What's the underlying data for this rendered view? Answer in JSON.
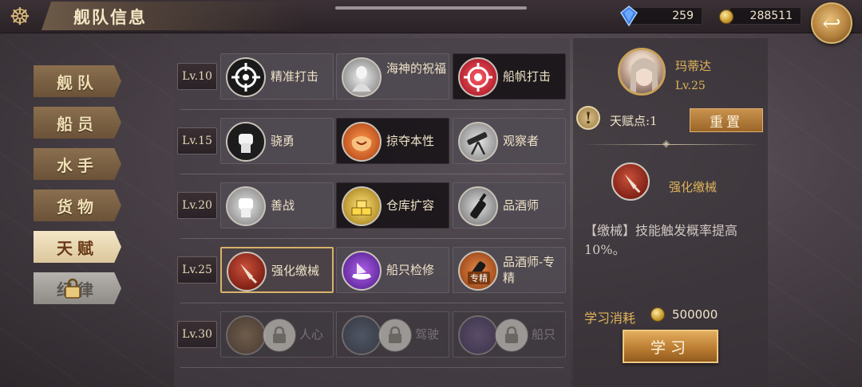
{
  "header": {
    "title": "舰队信息",
    "gems": "259",
    "gold": "288511"
  },
  "tabs": [
    {
      "label": "舰队",
      "state": "normal"
    },
    {
      "label": "船员",
      "state": "normal"
    },
    {
      "label": "水手",
      "state": "normal"
    },
    {
      "label": "货物",
      "state": "normal"
    },
    {
      "label": "天赋",
      "state": "active"
    },
    {
      "label": "纪律",
      "state": "locked"
    }
  ],
  "talent_rows": [
    {
      "level": "Lv.10",
      "skills": [
        {
          "name": "精准打击",
          "icon": "crosshair-icon"
        },
        {
          "name": "海神的祝福",
          "icon": "sea-god-icon"
        },
        {
          "name": "船帆打击",
          "icon": "sail-strike-icon",
          "style": "dark"
        }
      ]
    },
    {
      "level": "Lv.15",
      "skills": [
        {
          "name": "骁勇",
          "icon": "fist-icon"
        },
        {
          "name": "掠夺本性",
          "icon": "plunder-icon",
          "style": "dark"
        },
        {
          "name": "观察者",
          "icon": "telescope-icon"
        }
      ]
    },
    {
      "level": "Lv.20",
      "skills": [
        {
          "name": "善战",
          "icon": "fist-icon"
        },
        {
          "name": "仓库扩容",
          "icon": "gold-bars-icon",
          "style": "dark"
        },
        {
          "name": "品酒师",
          "icon": "wine-bottle-icon"
        }
      ]
    },
    {
      "level": "Lv.25",
      "skills": [
        {
          "name": "强化缴械",
          "icon": "dagger-icon",
          "style": "selected"
        },
        {
          "name": "船只检修",
          "icon": "ship-repair-icon"
        },
        {
          "name": "品酒师-专精",
          "icon": "wine-specialist-icon",
          "tag": "专精"
        }
      ]
    },
    {
      "level": "Lv.30",
      "skills": [
        {
          "name": "人心",
          "icon": "figure-icon",
          "style": "locked"
        },
        {
          "name": "驾驶",
          "icon": "helm-icon",
          "style": "locked"
        },
        {
          "name": "船只",
          "icon": "ship-icon",
          "style": "locked"
        }
      ]
    }
  ],
  "detail": {
    "character_name": "玛蒂达",
    "character_level": "Lv.25",
    "talent_points": "天赋点:1",
    "reset_label": "重置",
    "selected_skill": "强化缴械",
    "description": "【缴械】技能触发概率提高10%。",
    "cost_label": "学习消耗",
    "cost_value": "500000",
    "learn_label": "学习"
  }
}
